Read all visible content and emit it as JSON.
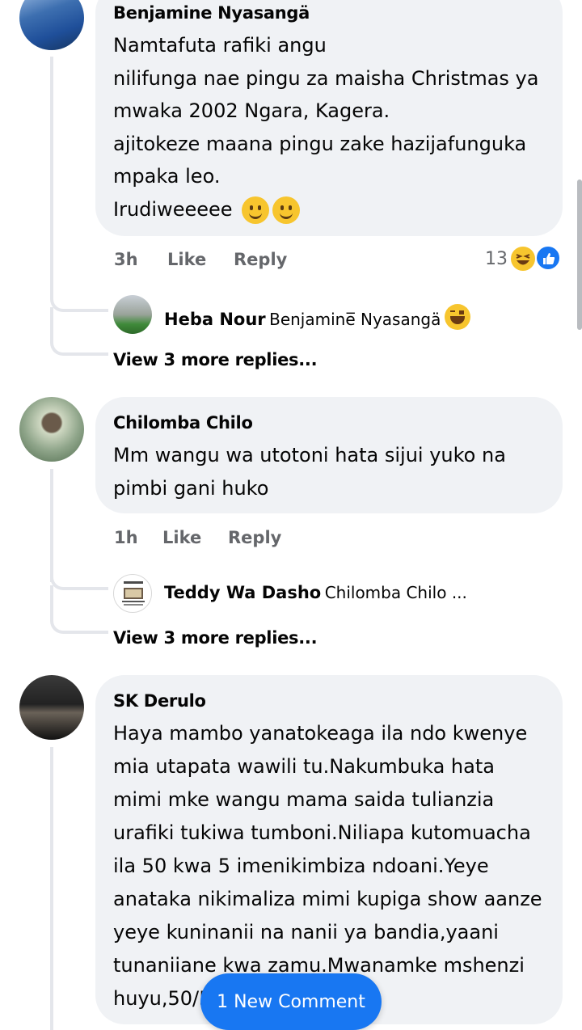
{
  "comments": [
    {
      "author": "Benjamine Nyasangä",
      "lines": [
        "Namtafuta rafiki angu",
        "nilifunga nae pingu za maisha Christmas ya",
        "mwaka 2002 Ngara, Kagera.",
        "ajitokeze maana pingu zake hazijafunguka",
        "mpaka leo.",
        "Irudiweeeee"
      ],
      "time": "3h",
      "like_label": "Like",
      "reply_label": "Reply",
      "reaction_count": "13",
      "reactions": [
        "haha-icon",
        "like-icon"
      ],
      "reply_preview": {
        "author": "Heba Nour",
        "text": "Benjamine̅ Nyasangä"
      },
      "view_more": "View 3 more replies..."
    },
    {
      "author": "Chilomba Chilo",
      "lines": [
        "Mm wangu wa utotoni hata sijui yuko na",
        "pimbi gani huko"
      ],
      "time": "1h",
      "like_label": "Like",
      "reply_label": "Reply",
      "reply_preview": {
        "author": "Teddy Wa Dasho",
        "text": "Chilomba Chilo ..."
      },
      "view_more": "View 3 more replies..."
    },
    {
      "author": "SK Derulo",
      "lines": [
        "Haya mambo yanatokeaga ila ndo kwenye",
        "mia utapata wawili tu.Nakumbuka hata",
        "mimi mke wangu mama saida tulianzia",
        "urafiki tukiwa tumboni.Niliapa kutomuacha",
        "ila 50 kwa 5 imenikimbiza ndoani.Yeye",
        "anataka nikimaliza mimi kupiga show aanze",
        "yeye kuninanii na nanii ya bandia,yaani",
        "tunaniiane kwa zamu.Mwanamke mshenzi",
        "huyu,50/5"
      ]
    }
  ],
  "new_comment_button": "1 New Comment",
  "colors": {
    "bubble": "#f0f2f5",
    "meta": "#65676b",
    "accent": "#1877f2"
  }
}
